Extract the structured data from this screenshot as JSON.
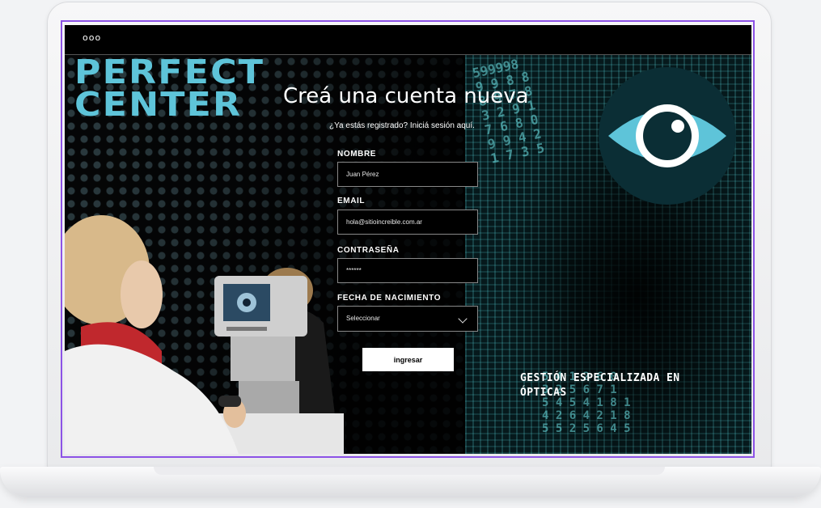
{
  "window": {
    "dots": "ooo"
  },
  "brand": {
    "line1": "PERFECT",
    "line2": "CENTER",
    "color": "#5ec4d9"
  },
  "form": {
    "title": "Creá una cuenta nueva",
    "login_prompt": "¿Ya estás registrado? Iniciá sesión aquí.",
    "fields": {
      "name": {
        "label": "NOMBRE",
        "value": "Juan Pérez"
      },
      "email": {
        "label": "EMAIL",
        "value": "hola@sitioincreible.com.ar"
      },
      "password": {
        "label": "CONTRASEÑA",
        "value": "******"
      },
      "birthdate": {
        "label": "FECHA DE NACIMIENTO",
        "value": "Seleccionar"
      }
    },
    "submit_label": "ingresar"
  },
  "tagline": {
    "line1": "GESTIÓN ESPECIALIZADA EN",
    "line2": "ÓPTICAS"
  },
  "colors": {
    "accent": "#5ec4d9",
    "outline": "#8c52e6",
    "digits": "#6fe3e6"
  },
  "icons": {
    "logo": "eye-icon",
    "select": "chevron-down-icon"
  },
  "decor": {
    "digits_left": "599998\n9 9 8 8\n8 9 7 8\n3 2 9 1\n7 6 8 0\n9 9 4 2\n1 7 3 5",
    "digits_bottom": "5 4 1 2 6 0\n3 2 5 6 7 1\n5 4 5 4 1 8 1\n4 2 6 4 2 1 8\n5 5 2 5 6 4 5"
  }
}
